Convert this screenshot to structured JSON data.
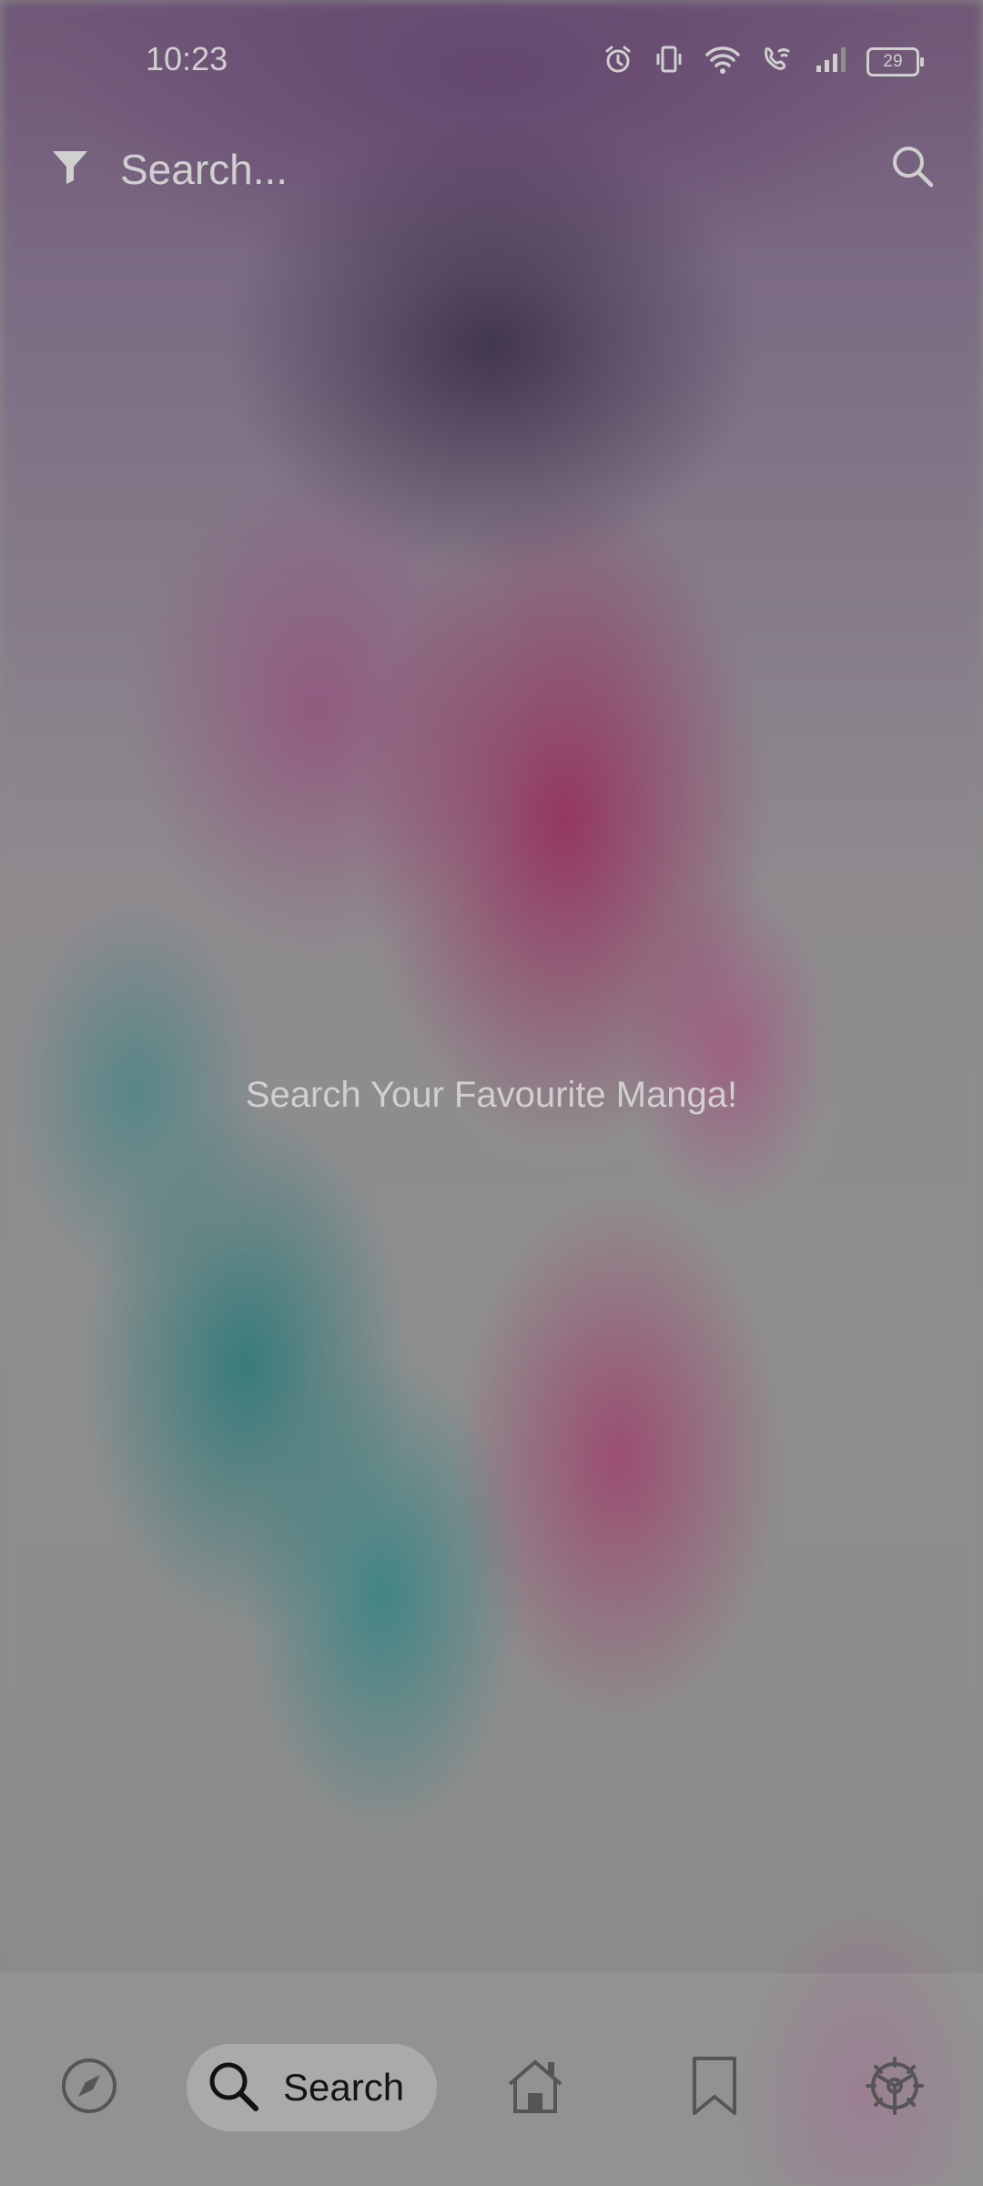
{
  "status_bar": {
    "time": "10:23",
    "battery_level": "29",
    "icons": [
      "alarm-icon",
      "vibrate-icon",
      "wifi-icon",
      "wifi-calling-icon",
      "signal-icon",
      "battery-icon"
    ]
  },
  "search": {
    "placeholder": "Search...",
    "filter_icon": "filter-icon",
    "search_icon": "search-icon"
  },
  "main": {
    "message": "Search Your Favourite Manga!"
  },
  "bottom_nav": {
    "items": [
      {
        "icon": "compass-icon",
        "label": ""
      },
      {
        "icon": "search-icon",
        "label": "Search",
        "active": true
      },
      {
        "icon": "home-icon",
        "label": ""
      },
      {
        "icon": "bookmark-icon",
        "label": ""
      },
      {
        "icon": "settings-icon",
        "label": ""
      }
    ]
  },
  "colors": {
    "text_muted": "#cfcfcf",
    "active_pill": "#bebebe",
    "nav_icon": "#555555"
  }
}
